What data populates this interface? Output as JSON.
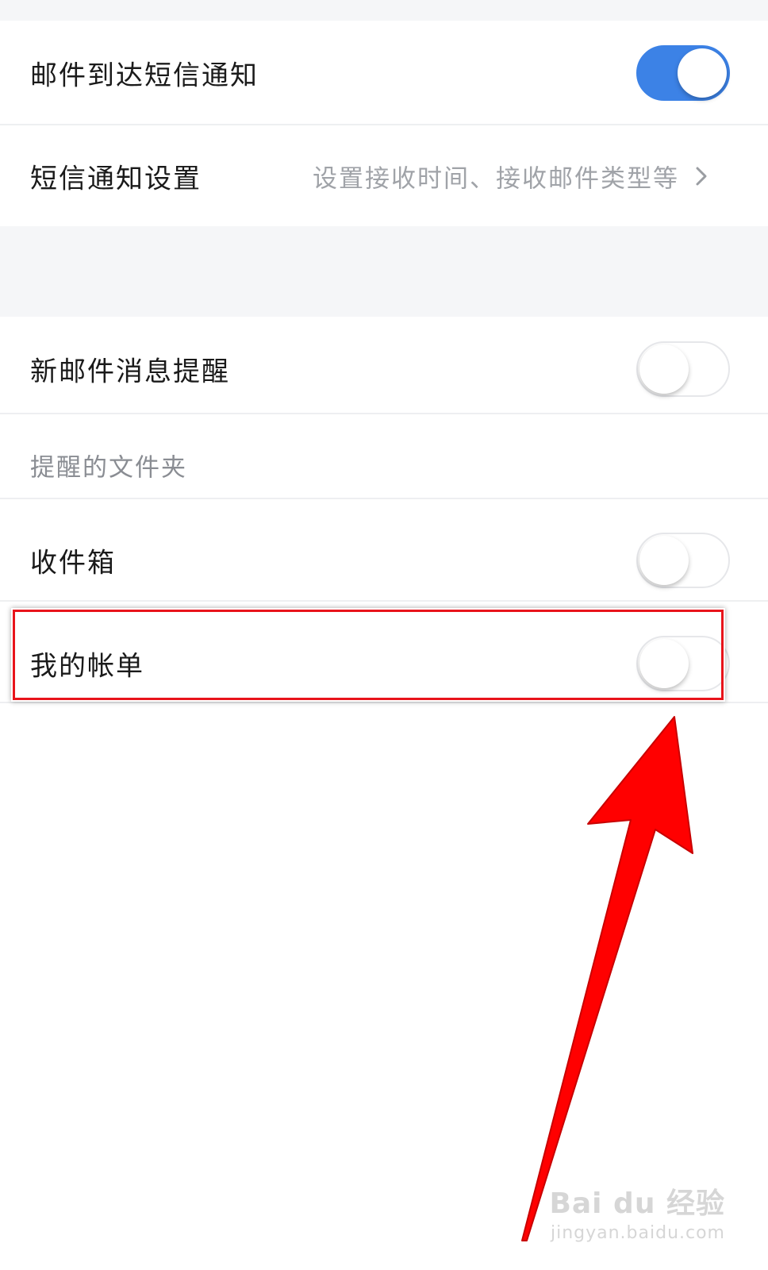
{
  "settings": {
    "sms_arrival": {
      "label": "邮件到达短信通知",
      "toggle_on": true
    },
    "sms_settings": {
      "label": "短信通知设置",
      "hint": "设置接收时间、接收邮件类型等"
    },
    "new_mail_alert": {
      "label": "新邮件消息提醒",
      "toggle_on": false
    },
    "folders_header": {
      "label": "提醒的文件夹"
    },
    "inbox": {
      "label": "收件箱",
      "toggle_on": false
    },
    "my_bills": {
      "label": "我的帐单",
      "toggle_on": false
    }
  },
  "colors": {
    "toggle_on": "#3c82e6",
    "highlight": "#e8141b",
    "arrow": "#ff0000"
  },
  "icons": {
    "chevron": "chevron-right-icon"
  },
  "watermark": {
    "brand": "Bai du 经验",
    "url": "jingyan.baidu.com"
  }
}
